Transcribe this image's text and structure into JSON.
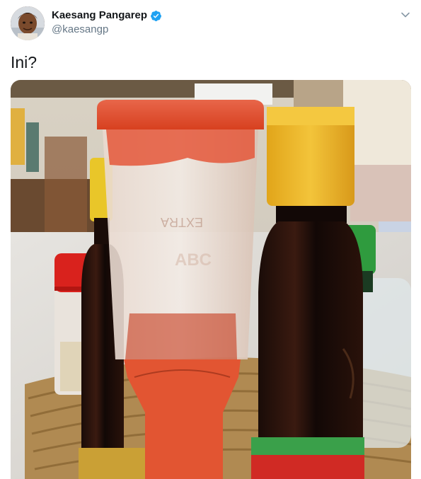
{
  "tweet": {
    "author": {
      "display_name": "Kaesang Pangarep",
      "handle": "@kaesangp",
      "verified": true
    },
    "text": "Ini?",
    "media": {
      "type": "photo",
      "label": "photo of condiment bottles in a woven basket"
    }
  },
  "icons": {
    "verified": "verified-badge-icon",
    "menu": "chevron-down-icon"
  },
  "colors": {
    "verified_blue": "#1da1f2",
    "handle_gray": "#657786",
    "text": "#14171a"
  }
}
